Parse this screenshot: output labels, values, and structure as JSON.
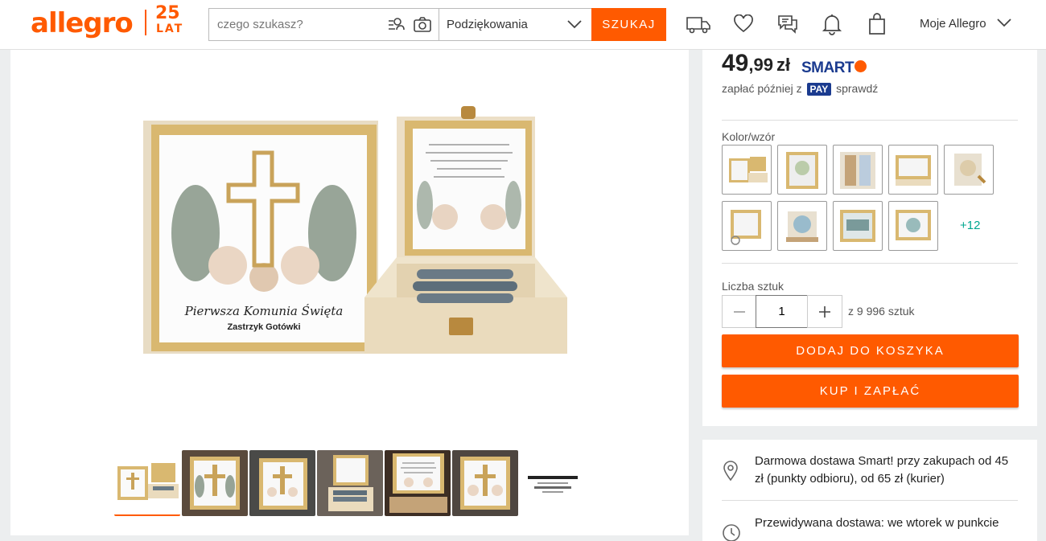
{
  "header": {
    "logo_text": "allegro",
    "logo_badge_number": "25",
    "logo_badge_text": "LAT",
    "search_placeholder": "czego szukasz?",
    "category_selected": "Podziękowania",
    "search_button": "SZUKAJ",
    "account_label": "Moje Allegro",
    "accent_color": "#ff5a00"
  },
  "product": {
    "price_main": "49",
    "price_decimal": ",99",
    "price_currency": "zł",
    "smart_label": "SMART",
    "pay_later_prefix": "zapłać później z",
    "pay_badge": "PAY",
    "pay_later_suffix": "sprawdź",
    "box_front_title": "Pierwsza Komunia Święta",
    "box_front_subtitle": "Zastrzyk Gotówki",
    "variant_label": "Kolor/wzór",
    "variant_more": "+12",
    "quantity_label": "Liczba sztuk",
    "quantity_value": "1",
    "quantity_available": "z 9 996 sztuk",
    "add_to_cart": "DODAJ DO KOSZYKA",
    "buy_now": "KUP I ZAPŁAĆ"
  },
  "delivery": {
    "free_delivery": "Darmowa dostawa Smart! przy zakupach od 45 zł (punkty odbioru), od 65 zł (kurier)",
    "expected": "Przewidywana dostawa: we wtorek w punkcie"
  }
}
